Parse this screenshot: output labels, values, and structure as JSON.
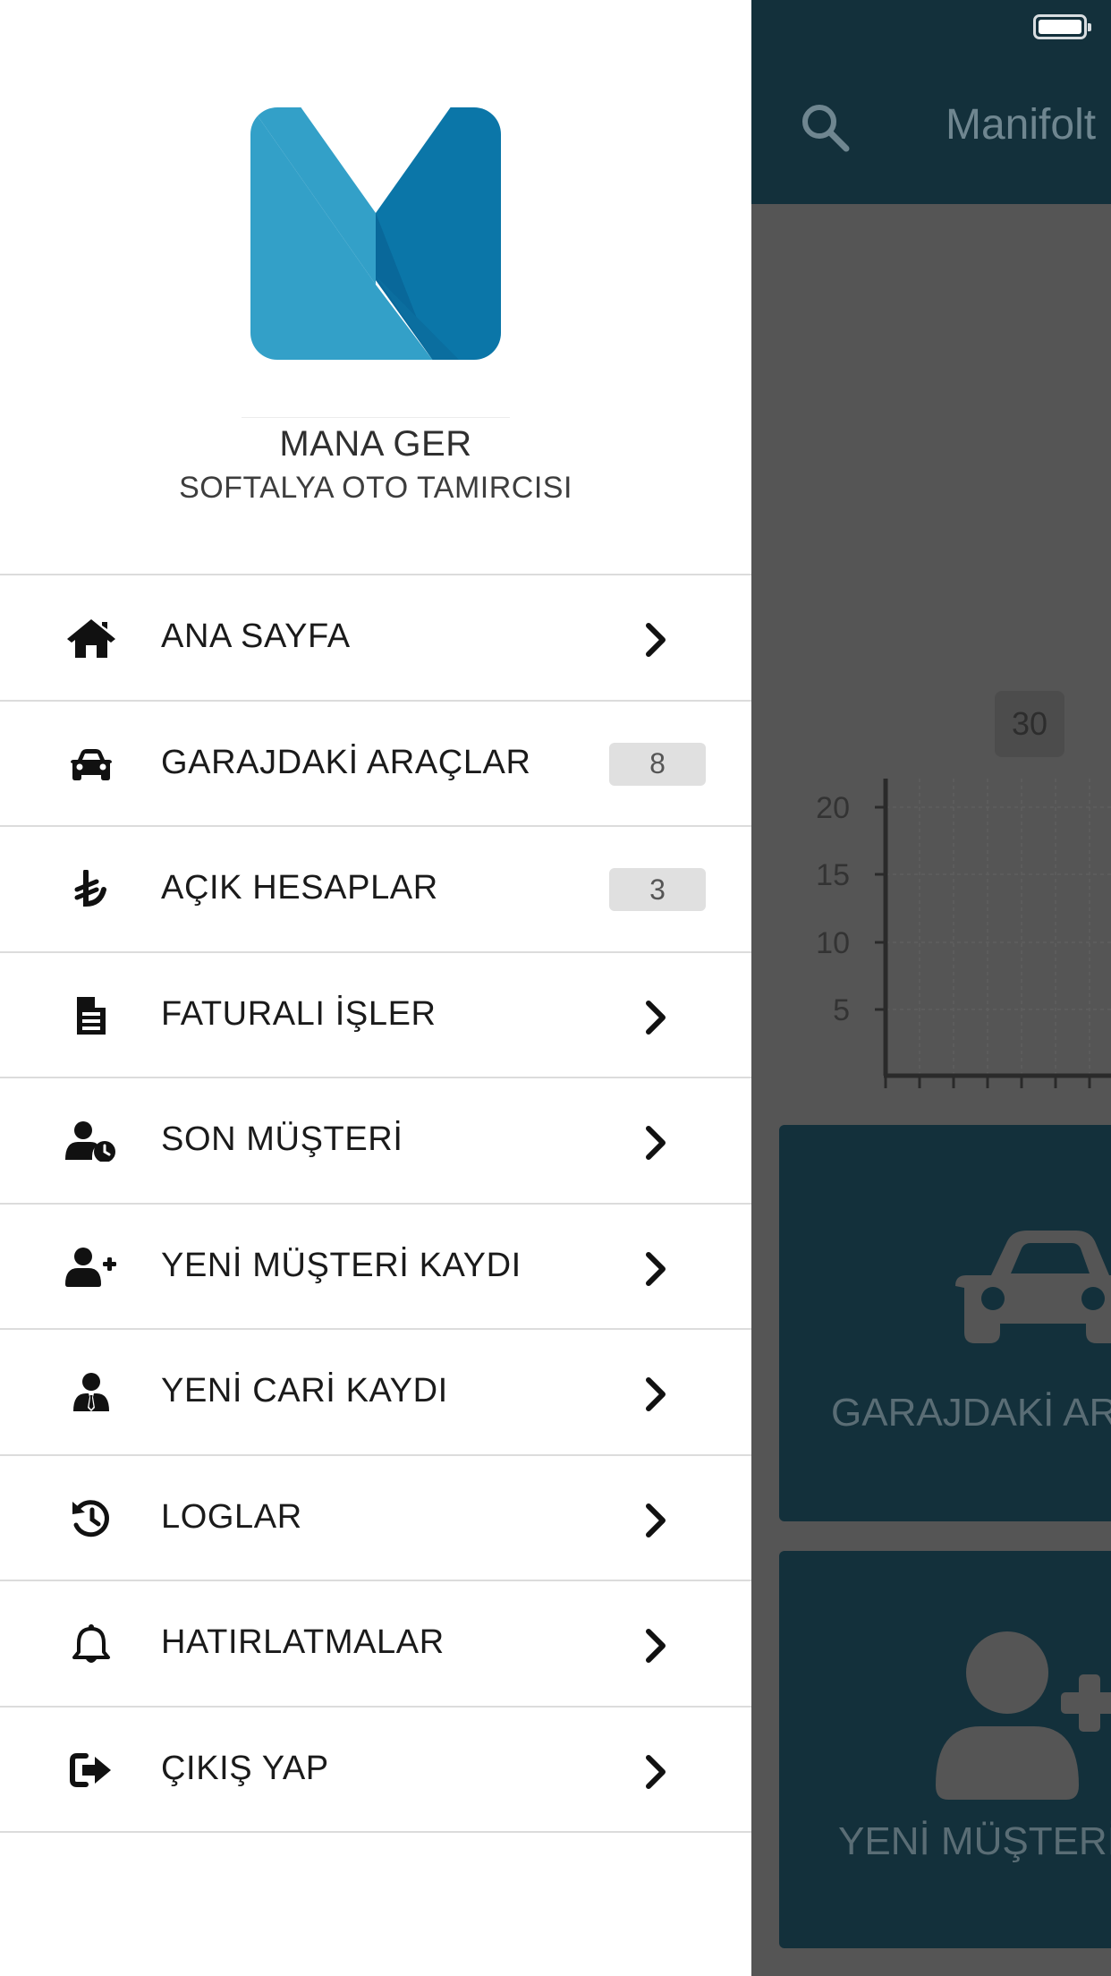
{
  "background_app": {
    "header_title": "Manifolt",
    "chart": {
      "tooltip_value": "30",
      "y_ticks": [
        "20",
        "15",
        "10",
        "5"
      ]
    },
    "tiles": [
      {
        "label": "GARAJDAKİ ARAÇLAR",
        "icon": "car-icon"
      },
      {
        "label": "YENİ MÜŞTERİ KAYDI",
        "icon": "user-plus-icon"
      }
    ]
  },
  "drawer": {
    "profile": {
      "name": "MANA GER",
      "company": "SOFTALYA OTO TAMIRCISI"
    },
    "menu": [
      {
        "label": "ANA SAYFA",
        "icon": "home-icon"
      },
      {
        "label": "GARAJDAKİ ARAÇLAR",
        "icon": "car-icon",
        "badge": "8"
      },
      {
        "label": "AÇIK HESAPLAR",
        "icon": "lira-icon",
        "badge": "3"
      },
      {
        "label": "FATURALI İŞLER",
        "icon": "invoice-icon"
      },
      {
        "label": "SON MÜŞTERİ",
        "icon": "user-clock-icon"
      },
      {
        "label": "YENİ MÜŞTERİ KAYDI",
        "icon": "user-plus-icon"
      },
      {
        "label": "YENİ CARİ KAYDI",
        "icon": "user-tie-icon"
      },
      {
        "label": "LOGLAR",
        "icon": "history-icon"
      },
      {
        "label": "HATIRLATMALAR",
        "icon": "bell-icon"
      },
      {
        "label": "ÇIKIŞ YAP",
        "icon": "sign-out-icon"
      }
    ]
  },
  "colors": {
    "header_dark": "#13303b",
    "overlay_gray": "#555555",
    "logo_light_blue": "#33a0c8",
    "logo_dark_blue": "#0b76a8"
  }
}
